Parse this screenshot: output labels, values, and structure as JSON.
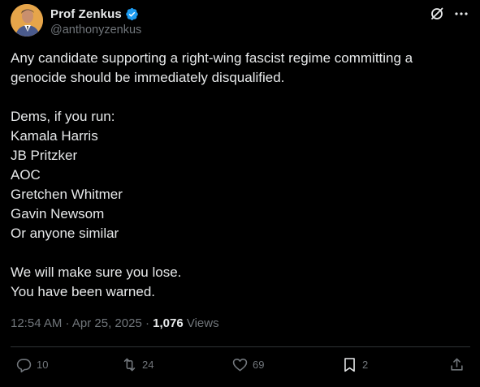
{
  "header_fragment": "",
  "author": {
    "display_name": "Prof Zenkus",
    "handle": "@anthonyzenkus",
    "verified": true,
    "avatar_color": "#e6a54a"
  },
  "tweet": {
    "paragraphs": [
      "Any candidate supporting a right-wing fascist regime committing a genocide should be immediately disqualified.",
      "Dems, if you run:\nKamala Harris\nJB Pritzker\nAOC\nGretchen Whitmer\nGavin Newsom\nOr anyone similar",
      "We will make sure you lose.\nYou have been warned."
    ]
  },
  "meta": {
    "time": "12:54 AM",
    "separator": " · ",
    "date": "Apr 25, 2025",
    "views_count": "1,076",
    "views_label": " Views"
  },
  "actions": {
    "replies": "10",
    "retweets": "24",
    "likes": "69",
    "bookmarks": "2"
  },
  "icons": {
    "verified": "verified-badge-icon",
    "grok": "grok-icon",
    "more": "more-icon",
    "reply": "reply-icon",
    "retweet": "retweet-icon",
    "like": "heart-icon",
    "bookmark": "bookmark-icon",
    "share": "share-icon"
  },
  "colors": {
    "background": "#000000",
    "text": "#e7e9ea",
    "secondary": "#71767b",
    "verified": "#1d9bf0",
    "divider": "#2f3336"
  }
}
